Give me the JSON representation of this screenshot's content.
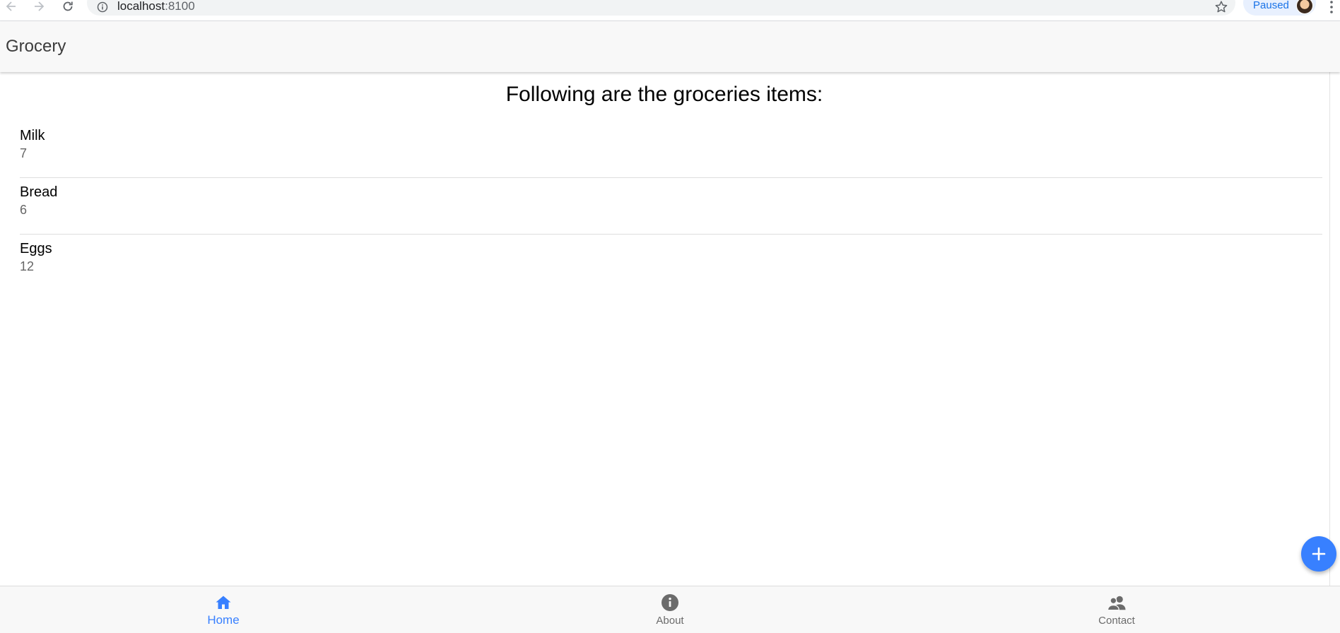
{
  "browser": {
    "url_host": "localhost",
    "url_port": ":8100",
    "profile_label": "Paused"
  },
  "app": {
    "title": "Grocery"
  },
  "page": {
    "heading": "Following are the groceries items:",
    "items": [
      {
        "name": "Milk",
        "quantity": "7"
      },
      {
        "name": "Bread",
        "quantity": "6"
      },
      {
        "name": "Eggs",
        "quantity": "12"
      }
    ]
  },
  "fab": {
    "icon": "plus-icon"
  },
  "tabs": [
    {
      "label": "Home",
      "icon": "home-icon",
      "selected": true
    },
    {
      "label": "About",
      "icon": "information-circle-icon",
      "selected": false
    },
    {
      "label": "Contact",
      "icon": "people-icon",
      "selected": false
    }
  ],
  "colors": {
    "primary": "#3880ff",
    "header_bg": "#f8f8f8",
    "tab_inactive": "#6b6b6b",
    "profile_chip_bg": "#e8f0fe",
    "profile_text": "#1a73e8"
  }
}
